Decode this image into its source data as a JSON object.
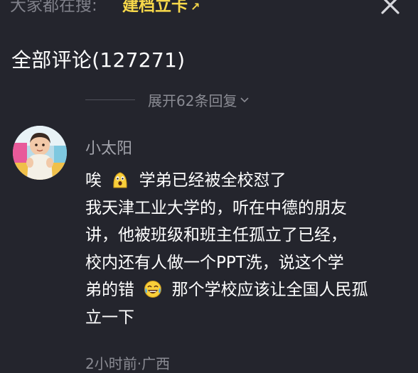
{
  "search": {
    "prefix": "大家都在搜:",
    "keyword": "建档立卡",
    "arrow": "↗"
  },
  "comments": {
    "header": "全部评论(127271)",
    "expand_label": "展开62条回复"
  },
  "comment": {
    "username": "小太阳",
    "lines": [
      [
        "唉",
        "学弟已经被全校怼了"
      ],
      [
        "我天津工业大学的，听在中德的朋友"
      ],
      [
        "讲，他被班级和班主任孤立了已经，"
      ],
      [
        "校内还有人做一个PPT洗，说这个学"
      ],
      [
        "弟的错",
        "那个学校应该让全国人民孤"
      ],
      [
        "立一下"
      ]
    ],
    "meta": "2小时前·广西",
    "emoji_1": "scared-emoji",
    "emoji_2": "crying-laughing-emoji"
  },
  "colors": {
    "background": "#24252d",
    "keyword": "#f7d84a",
    "muted": "#8a8b93",
    "text": "#ffffff"
  }
}
